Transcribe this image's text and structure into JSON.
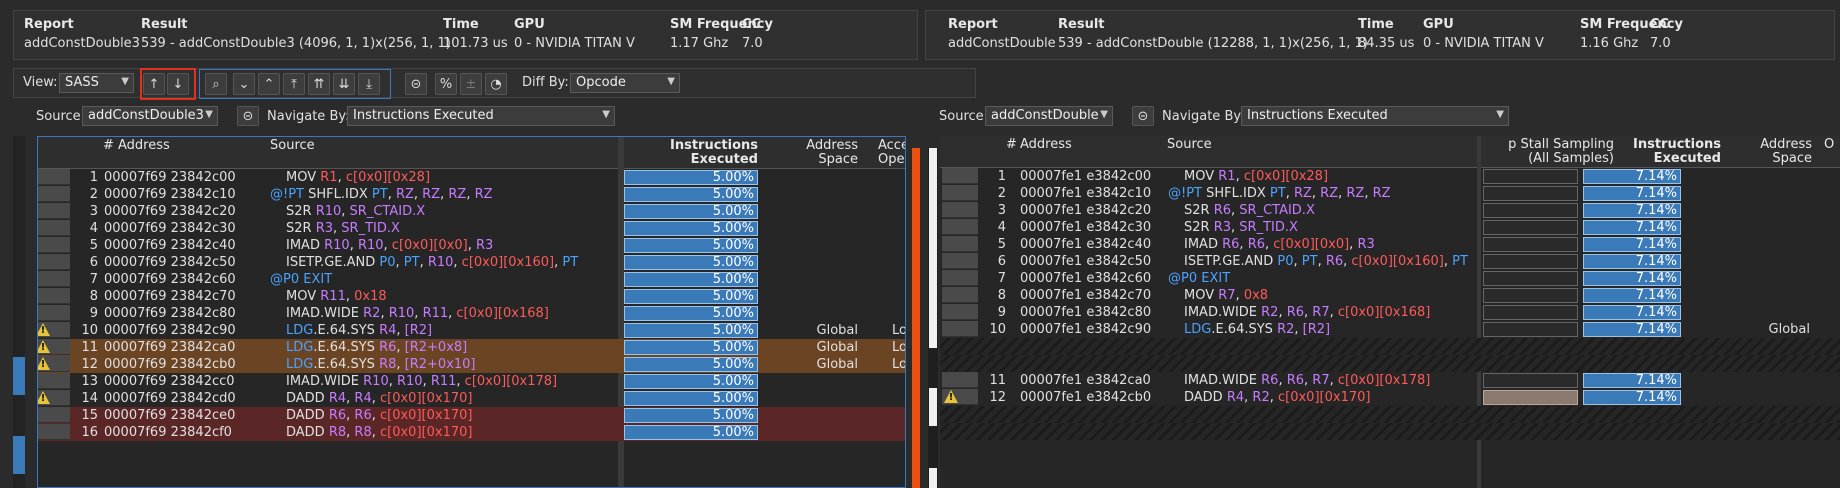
{
  "left_report": {
    "headers": {
      "report": "Report",
      "result": "Result",
      "time": "Time",
      "gpu": "GPU",
      "smfreq": "SM Frequency",
      "cc": "CC"
    },
    "report": "addConstDouble3",
    "result": "539 - addConstDouble3 (4096, 1, 1)x(256, 1, 1)",
    "time": "101.73 us",
    "gpu": "0 - NVIDIA TITAN V",
    "smfreq": "1.17 Ghz",
    "cc": "7.0"
  },
  "right_report": {
    "headers": {
      "report": "Report",
      "result": "Result",
      "time": "Time",
      "gpu": "GPU",
      "smfreq": "SM Frequency",
      "cc": "CC"
    },
    "report": "addConstDouble",
    "result": "539 - addConstDouble (12288, 1, 1)x(256, 1, 1)",
    "time": "84.35 us",
    "gpu": "0 - NVIDIA TITAN V",
    "smfreq": "1.16 Ghz",
    "cc": "7.0"
  },
  "toolbar": {
    "view_label": "View:",
    "view_value": "SASS",
    "diff_label": "Diff By:",
    "diff_value": "Opcode",
    "up_glyph": "↑",
    "down_glyph": "↓",
    "highlight_color": "#e0301e"
  },
  "left_source": {
    "source_label": "Source:",
    "source_value": "addConstDouble3",
    "navigate_label": "Navigate By:",
    "navigate_value": "Instructions Executed",
    "columns": {
      "num": "#",
      "address": "Address",
      "source": "Source",
      "instr1": "Instructions",
      "instr2": "Executed",
      "addr1": "Address",
      "addr2": "Space",
      "acc1": "Acce",
      "acc2": "Operat"
    },
    "rows": [
      {
        "n": "1",
        "addr": "00007f69 23842c00",
        "pred": "",
        "op": "MOV",
        "args": [
          [
            "R1",
            "r"
          ],
          [
            ", ",
            "m"
          ],
          [
            "c[0x0][0x28]",
            "r"
          ]
        ],
        "pct": "5.00%",
        "space": "",
        "acc": "",
        "warn": false,
        "hl": ""
      },
      {
        "n": "2",
        "addr": "00007f69 23842c10",
        "pred": "@!PT",
        "op": "SHFL.IDX",
        "args": [
          [
            "PT",
            "b"
          ],
          [
            ", ",
            "m"
          ],
          [
            "RZ",
            "p"
          ],
          [
            ", ",
            "m"
          ],
          [
            "RZ",
            "p"
          ],
          [
            ", ",
            "m"
          ],
          [
            "RZ",
            "p"
          ],
          [
            ", ",
            "m"
          ],
          [
            "RZ",
            "p"
          ]
        ],
        "pct": "5.00%",
        "space": "",
        "acc": "",
        "warn": false,
        "hl": ""
      },
      {
        "n": "3",
        "addr": "00007f69 23842c20",
        "pred": "",
        "op": "S2R",
        "args": [
          [
            "R10",
            "p"
          ],
          [
            ", ",
            "m"
          ],
          [
            "SR_CTAID.X",
            "p"
          ]
        ],
        "pct": "5.00%",
        "space": "",
        "acc": "",
        "warn": false,
        "hl": ""
      },
      {
        "n": "4",
        "addr": "00007f69 23842c30",
        "pred": "",
        "op": "S2R",
        "args": [
          [
            "R3",
            "p"
          ],
          [
            ", ",
            "m"
          ],
          [
            "SR_TID.X",
            "p"
          ]
        ],
        "pct": "5.00%",
        "space": "",
        "acc": "",
        "warn": false,
        "hl": ""
      },
      {
        "n": "5",
        "addr": "00007f69 23842c40",
        "pred": "",
        "op": "IMAD",
        "args": [
          [
            "R10",
            "p"
          ],
          [
            ", ",
            "m"
          ],
          [
            "R10",
            "p"
          ],
          [
            ", ",
            "m"
          ],
          [
            "c[0x0][0x0]",
            "r"
          ],
          [
            ", ",
            "m"
          ],
          [
            "R3",
            "p"
          ]
        ],
        "pct": "5.00%",
        "space": "",
        "acc": "",
        "warn": false,
        "hl": ""
      },
      {
        "n": "6",
        "addr": "00007f69 23842c50",
        "pred": "",
        "op": "ISETP.GE.AND",
        "args": [
          [
            "P0",
            "b"
          ],
          [
            ", ",
            "m"
          ],
          [
            "PT",
            "b"
          ],
          [
            ", ",
            "m"
          ],
          [
            "R10",
            "p"
          ],
          [
            ", ",
            "m"
          ],
          [
            "c[0x0][0x160]",
            "r"
          ],
          [
            ", ",
            "m"
          ],
          [
            "PT",
            "b"
          ]
        ],
        "pct": "5.00%",
        "space": "",
        "acc": "",
        "warn": false,
        "hl": ""
      },
      {
        "n": "7",
        "addr": "00007f69 23842c60",
        "pred": "@P0",
        "op": "EXIT",
        "opc": "b",
        "args": [],
        "pct": "5.00%",
        "space": "",
        "acc": "",
        "warn": false,
        "hl": ""
      },
      {
        "n": "8",
        "addr": "00007f69 23842c70",
        "pred": "",
        "op": "MOV",
        "args": [
          [
            "R11",
            "p"
          ],
          [
            ", ",
            "m"
          ],
          [
            "0x18",
            "r"
          ]
        ],
        "pct": "5.00%",
        "space": "",
        "acc": "",
        "warn": false,
        "hl": ""
      },
      {
        "n": "9",
        "addr": "00007f69 23842c80",
        "pred": "",
        "op": "IMAD.WIDE",
        "args": [
          [
            "R2",
            "p"
          ],
          [
            ", ",
            "m"
          ],
          [
            "R10",
            "p"
          ],
          [
            ", ",
            "m"
          ],
          [
            "R11",
            "p"
          ],
          [
            ", ",
            "m"
          ],
          [
            "c[0x0][0x168]",
            "r"
          ]
        ],
        "pct": "5.00%",
        "space": "",
        "acc": "",
        "warn": false,
        "hl": ""
      },
      {
        "n": "10",
        "addr": "00007f69 23842c90",
        "pred": "",
        "op": "LDG",
        "opc": "b",
        "opsuffix": ".E.64.SYS",
        "args": [
          [
            "R4",
            "p"
          ],
          [
            ", ",
            "m"
          ],
          [
            "[R2]",
            "p"
          ]
        ],
        "pct": "5.00%",
        "space": "Global",
        "acc": "Lo",
        "warn": true,
        "hl": ""
      },
      {
        "n": "11",
        "addr": "00007f69 23842ca0",
        "pred": "",
        "op": "LDG",
        "opc": "b",
        "opsuffix": ".E.64.SYS",
        "args": [
          [
            "R6",
            "p"
          ],
          [
            ", ",
            "m"
          ],
          [
            "[R2+0x8]",
            "p"
          ]
        ],
        "pct": "5.00%",
        "space": "Global",
        "acc": "Lo",
        "warn": true,
        "hl": "#6b4424"
      },
      {
        "n": "12",
        "addr": "00007f69 23842cb0",
        "pred": "",
        "op": "LDG",
        "opc": "b",
        "opsuffix": ".E.64.SYS",
        "args": [
          [
            "R8",
            "p"
          ],
          [
            ", ",
            "m"
          ],
          [
            "[R2+0x10]",
            "p"
          ]
        ],
        "pct": "5.00%",
        "space": "Global",
        "acc": "Lo",
        "warn": true,
        "hl": "#6b4424"
      },
      {
        "n": "13",
        "addr": "00007f69 23842cc0",
        "pred": "",
        "op": "IMAD.WIDE",
        "args": [
          [
            "R10",
            "p"
          ],
          [
            ", ",
            "m"
          ],
          [
            "R10",
            "p"
          ],
          [
            ", ",
            "m"
          ],
          [
            "R11",
            "p"
          ],
          [
            ", ",
            "m"
          ],
          [
            "c[0x0][0x178]",
            "r"
          ]
        ],
        "pct": "5.00%",
        "space": "",
        "acc": "",
        "warn": false,
        "hl": ""
      },
      {
        "n": "14",
        "addr": "00007f69 23842cd0",
        "pred": "",
        "op": "DADD",
        "args": [
          [
            "R4",
            "p"
          ],
          [
            ", ",
            "m"
          ],
          [
            "R4",
            "p"
          ],
          [
            ", ",
            "m"
          ],
          [
            "c[0x0][0x170]",
            "r"
          ]
        ],
        "pct": "5.00%",
        "space": "",
        "acc": "",
        "warn": true,
        "hl": ""
      },
      {
        "n": "15",
        "addr": "00007f69 23842ce0",
        "pred": "",
        "op": "DADD",
        "args": [
          [
            "R6",
            "p"
          ],
          [
            ", ",
            "m"
          ],
          [
            "R6",
            "p"
          ],
          [
            ", ",
            "m"
          ],
          [
            "c[0x0][0x170]",
            "r"
          ]
        ],
        "pct": "5.00%",
        "space": "",
        "acc": "",
        "warn": false,
        "hl": "#5a2626"
      },
      {
        "n": "16",
        "addr": "00007f69 23842cf0",
        "pred": "",
        "op": "DADD",
        "args": [
          [
            "R8",
            "p"
          ],
          [
            ", ",
            "m"
          ],
          [
            "R8",
            "p"
          ],
          [
            ", ",
            "m"
          ],
          [
            "c[0x0][0x170]",
            "r"
          ]
        ],
        "pct": "5.00%",
        "space": "",
        "acc": "",
        "warn": false,
        "hl": "#5a2626"
      }
    ]
  },
  "right_source": {
    "source_label": "Source:",
    "source_value": "addConstDouble",
    "navigate_label": "Navigate By:",
    "navigate_value": "Instructions Executed",
    "columns": {
      "num": "#",
      "address": "Address",
      "source": "Source",
      "stall1": "p Stall Sampling",
      "stall2": "(All Samples)",
      "instr1": "Instructions",
      "instr2": "Executed",
      "addr1": "Address",
      "addr2": "Space",
      "acc1": "O"
    },
    "rows": [
      {
        "n": "1",
        "addr": "00007fe1 e3842c00",
        "pred": "",
        "op": "MOV",
        "args": [
          [
            "R1",
            "p"
          ],
          [
            ", ",
            "m"
          ],
          [
            "c[0x0][0x28]",
            "r"
          ]
        ],
        "pct": "7.14%",
        "space": "",
        "warn": false
      },
      {
        "n": "2",
        "addr": "00007fe1 e3842c10",
        "pred": "@!PT",
        "op": "SHFL.IDX",
        "args": [
          [
            "PT",
            "b"
          ],
          [
            ", ",
            "m"
          ],
          [
            "RZ",
            "p"
          ],
          [
            ", ",
            "m"
          ],
          [
            "RZ",
            "p"
          ],
          [
            ", ",
            "m"
          ],
          [
            "RZ",
            "p"
          ],
          [
            ", ",
            "m"
          ],
          [
            "RZ",
            "p"
          ]
        ],
        "pct": "7.14%",
        "space": "",
        "warn": false
      },
      {
        "n": "3",
        "addr": "00007fe1 e3842c20",
        "pred": "",
        "op": "S2R",
        "args": [
          [
            "R6",
            "p"
          ],
          [
            ", ",
            "m"
          ],
          [
            "SR_CTAID.X",
            "p"
          ]
        ],
        "pct": "7.14%",
        "space": "",
        "warn": false
      },
      {
        "n": "4",
        "addr": "00007fe1 e3842c30",
        "pred": "",
        "op": "S2R",
        "args": [
          [
            "R3",
            "p"
          ],
          [
            ", ",
            "m"
          ],
          [
            "SR_TID.X",
            "p"
          ]
        ],
        "pct": "7.14%",
        "space": "",
        "warn": false
      },
      {
        "n": "5",
        "addr": "00007fe1 e3842c40",
        "pred": "",
        "op": "IMAD",
        "args": [
          [
            "R6",
            "p"
          ],
          [
            ", ",
            "m"
          ],
          [
            "R6",
            "p"
          ],
          [
            ", ",
            "m"
          ],
          [
            "c[0x0][0x0]",
            "r"
          ],
          [
            ", ",
            "m"
          ],
          [
            "R3",
            "p"
          ]
        ],
        "pct": "7.14%",
        "space": "",
        "warn": false
      },
      {
        "n": "6",
        "addr": "00007fe1 e3842c50",
        "pred": "",
        "op": "ISETP.GE.AND",
        "args": [
          [
            "P0",
            "b"
          ],
          [
            ", ",
            "m"
          ],
          [
            "PT",
            "b"
          ],
          [
            ", ",
            "m"
          ],
          [
            "R6",
            "p"
          ],
          [
            ", ",
            "m"
          ],
          [
            "c[0x0][0x160]",
            "r"
          ],
          [
            ", ",
            "m"
          ],
          [
            "PT",
            "b"
          ]
        ],
        "pct": "7.14%",
        "space": "",
        "warn": false
      },
      {
        "n": "7",
        "addr": "00007fe1 e3842c60",
        "pred": "@P0",
        "op": "EXIT",
        "opc": "b",
        "args": [],
        "pct": "7.14%",
        "space": "",
        "warn": false
      },
      {
        "n": "8",
        "addr": "00007fe1 e3842c70",
        "pred": "",
        "op": "MOV",
        "args": [
          [
            "R7",
            "p"
          ],
          [
            ", ",
            "m"
          ],
          [
            "0x8",
            "r"
          ]
        ],
        "pct": "7.14%",
        "space": "",
        "warn": false
      },
      {
        "n": "9",
        "addr": "00007fe1 e3842c80",
        "pred": "",
        "op": "IMAD.WIDE",
        "args": [
          [
            "R2",
            "p"
          ],
          [
            ", ",
            "m"
          ],
          [
            "R6",
            "p"
          ],
          [
            ", ",
            "m"
          ],
          [
            "R7",
            "p"
          ],
          [
            ", ",
            "m"
          ],
          [
            "c[0x0][0x168]",
            "r"
          ]
        ],
        "pct": "7.14%",
        "space": "",
        "warn": false
      },
      {
        "n": "10",
        "addr": "00007fe1 e3842c90",
        "pred": "",
        "op": "LDG",
        "opc": "b",
        "opsuffix": ".E.64.SYS",
        "args": [
          [
            "R2",
            "p"
          ],
          [
            ", ",
            "m"
          ],
          [
            "[R2]",
            "p"
          ]
        ],
        "pct": "7.14%",
        "space": "Global",
        "warn": false
      },
      {
        "n": "",
        "gap": true
      },
      {
        "n": "",
        "gap": true
      },
      {
        "n": "11",
        "addr": "00007fe1 e3842ca0",
        "pred": "",
        "op": "IMAD.WIDE",
        "args": [
          [
            "R6",
            "p"
          ],
          [
            ", ",
            "m"
          ],
          [
            "R6",
            "p"
          ],
          [
            ", ",
            "m"
          ],
          [
            "R7",
            "p"
          ],
          [
            ", ",
            "m"
          ],
          [
            "c[0x0][0x178]",
            "r"
          ]
        ],
        "pct": "7.14%",
        "space": "",
        "warn": false
      },
      {
        "n": "12",
        "addr": "00007fe1 e3842cb0",
        "pred": "",
        "op": "DADD",
        "args": [
          [
            "R4",
            "p"
          ],
          [
            ", ",
            "m"
          ],
          [
            "R2",
            "p"
          ],
          [
            ", ",
            "m"
          ],
          [
            "c[0x0][0x170]",
            "r"
          ]
        ],
        "pct": "7.14%",
        "space": "",
        "warn": true,
        "stallbar": true
      },
      {
        "n": "",
        "gap": true
      },
      {
        "n": "",
        "gap": true
      }
    ]
  }
}
